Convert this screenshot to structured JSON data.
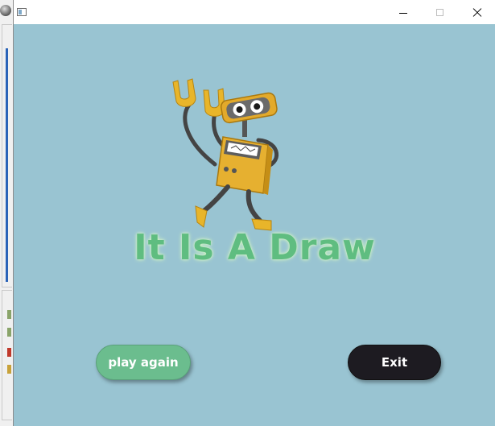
{
  "window": {
    "title": "",
    "controls": {
      "minimize": "minimize",
      "maximize": "maximize",
      "close": "close"
    }
  },
  "game": {
    "result_text": "It Is A Draw",
    "buttons": {
      "play_again": "play again",
      "exit": "Exit"
    },
    "mascot_icon": "robot-mascot"
  },
  "colors": {
    "background": "#99c4d2",
    "title_text": "#5fbd80",
    "play_again_button": "#6bbd8e",
    "exit_button": "#1d1b21",
    "robot_body": "#e6b030"
  }
}
